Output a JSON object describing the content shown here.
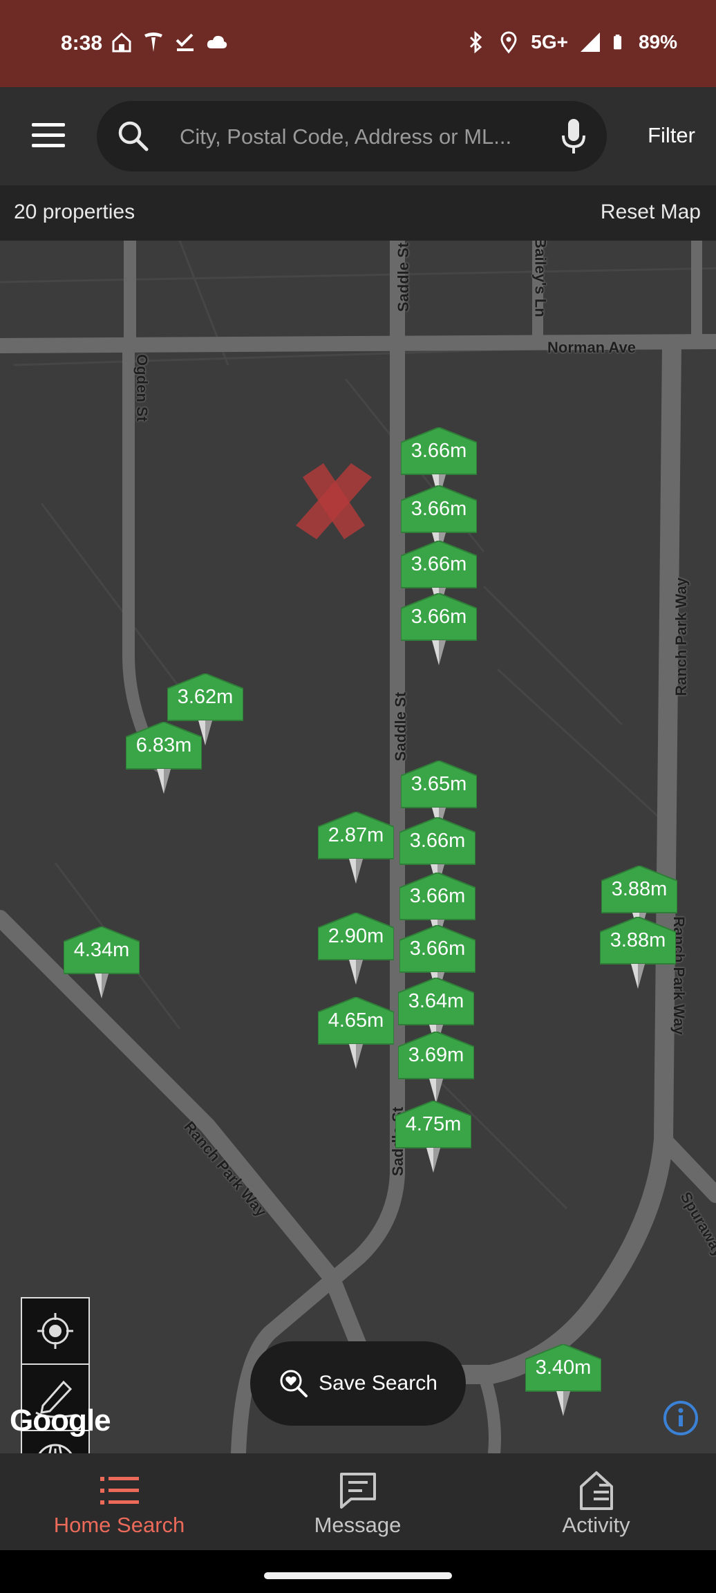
{
  "status_bar": {
    "time": "8:38",
    "network": "5G+",
    "battery": "89%"
  },
  "search": {
    "placeholder": "City, Postal Code, Address or ML...",
    "filter_label": "Filter"
  },
  "results": {
    "count_label": "20 properties",
    "reset_label": "Reset Map"
  },
  "map": {
    "streets": [
      "Saddle St",
      "Bailey's Ln",
      "Norman Ave",
      "Ogden St",
      "Ranch Park Way",
      "Saddle St",
      "Ranch Park Way",
      "Ranch Park Way",
      "Saddle St",
      "Spuraway"
    ],
    "pins": [
      "3.66m",
      "3.66m",
      "3.66m",
      "3.66m",
      "3.62m",
      "6.83m",
      "3.65m",
      "2.87m",
      "3.66m",
      "3.66m",
      "2.90m",
      "3.66m",
      "4.34m",
      "3.88m",
      "3.88m",
      "3.64m",
      "4.65m",
      "3.69m",
      "4.75m",
      "3.40m"
    ],
    "pin_color": "#3aa547",
    "attribution": "Google"
  },
  "map_tools": [
    "locate-icon",
    "draw-icon",
    "road-icon",
    "home-3d-icon",
    "globe-icon"
  ],
  "save_search": {
    "label": "Save Search"
  },
  "bottom_nav": [
    {
      "label": "Home Search",
      "icon": "list-icon",
      "active": true
    },
    {
      "label": "Message",
      "icon": "message-icon",
      "active": false
    },
    {
      "label": "Activity",
      "icon": "activity-icon",
      "active": false
    }
  ],
  "colors": {
    "status_bar": "#6e2a24",
    "accent": "#ec6a5a",
    "pin_green": "#3aa547"
  }
}
